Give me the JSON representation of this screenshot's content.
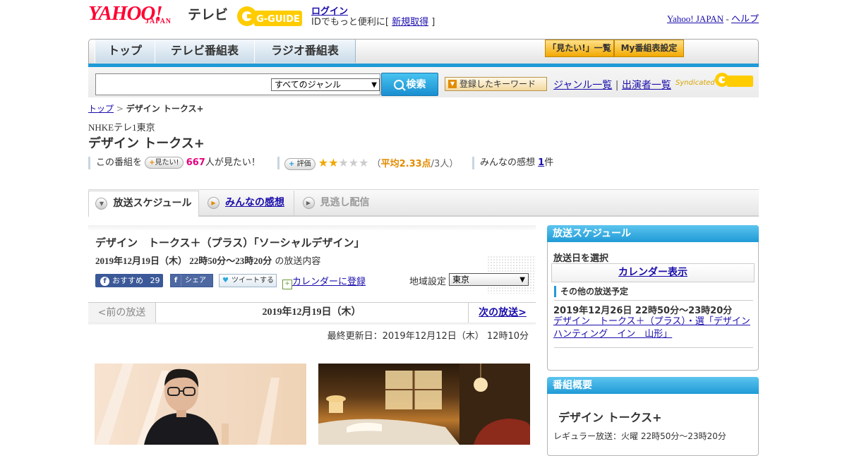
{
  "header": {
    "logo_text": "YAHOO!",
    "logo_sub": "JAPAN",
    "tv_word": "テレビ",
    "gguide_text": "G-GUIDE",
    "login_label": "ログイン",
    "login_message_prefix": "IDでもっと便利に[",
    "register_label": "新規取得",
    "login_message_suffix": "]",
    "yahoo_japan_link": "Yahoo! JAPAN",
    "separator": "-",
    "help_link": "ヘルプ"
  },
  "nav": {
    "tabs": [
      {
        "label": "トップ"
      },
      {
        "label": "テレビ番組表"
      },
      {
        "label": "ラジオ番組表"
      }
    ],
    "watchlist_button": "「見たい!」一覧",
    "my_schedule_button": "My番組表設定"
  },
  "search": {
    "query": "",
    "genre_selected": "すべてのジャンル",
    "search_button": "検索",
    "keyword_button": "登録したキーワード",
    "genre_list_link": "ジャンル一覧",
    "divider": "|",
    "performer_list_link": "出演者一覧",
    "syndicated_text": "Syndicated"
  },
  "breadcrumb": {
    "home": "トップ",
    "separator": ">",
    "current": "デザイン トークス+"
  },
  "program": {
    "station": "NHKEテレ1東京",
    "title": "デザイン トークス+",
    "want_prefix": "この番組を",
    "want_pill": "見たい!",
    "want_count": "667",
    "want_suffix": "人が見たい！",
    "rating_pill": "評価",
    "rating_stars": 2,
    "rating_text_open": "（",
    "rating_average": "平均2.33点",
    "rating_count": "/3人）",
    "impressions_label": "みんなの感想",
    "impressions_count": "1",
    "impressions_unit": "件"
  },
  "content_tabs": [
    {
      "label": "放送スケジュール",
      "state": "active"
    },
    {
      "label": "みんなの感想",
      "state": "link"
    },
    {
      "label": "見逃し配信",
      "state": "disabled"
    }
  ],
  "episode": {
    "title": "デザイン　トークス＋（プラス）「ソーシャルデザイン」",
    "date_time": "2019年12月19日（木） 22時50分～23時20分",
    "date_suffix": "の放送内容",
    "facebook_label": "おすすめ",
    "facebook_count": "29",
    "share_label": "シェア",
    "tweet_label": "ツイートする",
    "calendar_label": "カレンダーに登録",
    "region_label": "地域設定",
    "region_selected": "東京",
    "prev_label": "<前の放送",
    "current_date": "2019年12月19日（木）",
    "next_label": "次の放送>",
    "updated": "最終更新日：2019年12月12日（木） 12時10分"
  },
  "sidebar": {
    "schedule_header": "放送スケジュール",
    "select_date_label": "放送日を選択",
    "calendar_button": "カレンダー表示",
    "other_broadcasts_header": "その他の放送予定",
    "other_date": "2019年12月26日 22時50分～23時20分",
    "other_link": "デザイン　トークス＋（プラス）・選「デザインハンティング　イン　山形」",
    "overview_header": "番組概要",
    "overview_title": "デザイン トークス+",
    "regular_broadcast": "レギュラー放送：火曜 22時50分～23時20分"
  },
  "colors": {
    "yahoo_red": "#ff0033",
    "accent_blue": "#1f9ad6",
    "link_blue": "#1a0dab",
    "gold": "#f2a900",
    "pink": "#e4007f",
    "orange": "#e38b00"
  }
}
